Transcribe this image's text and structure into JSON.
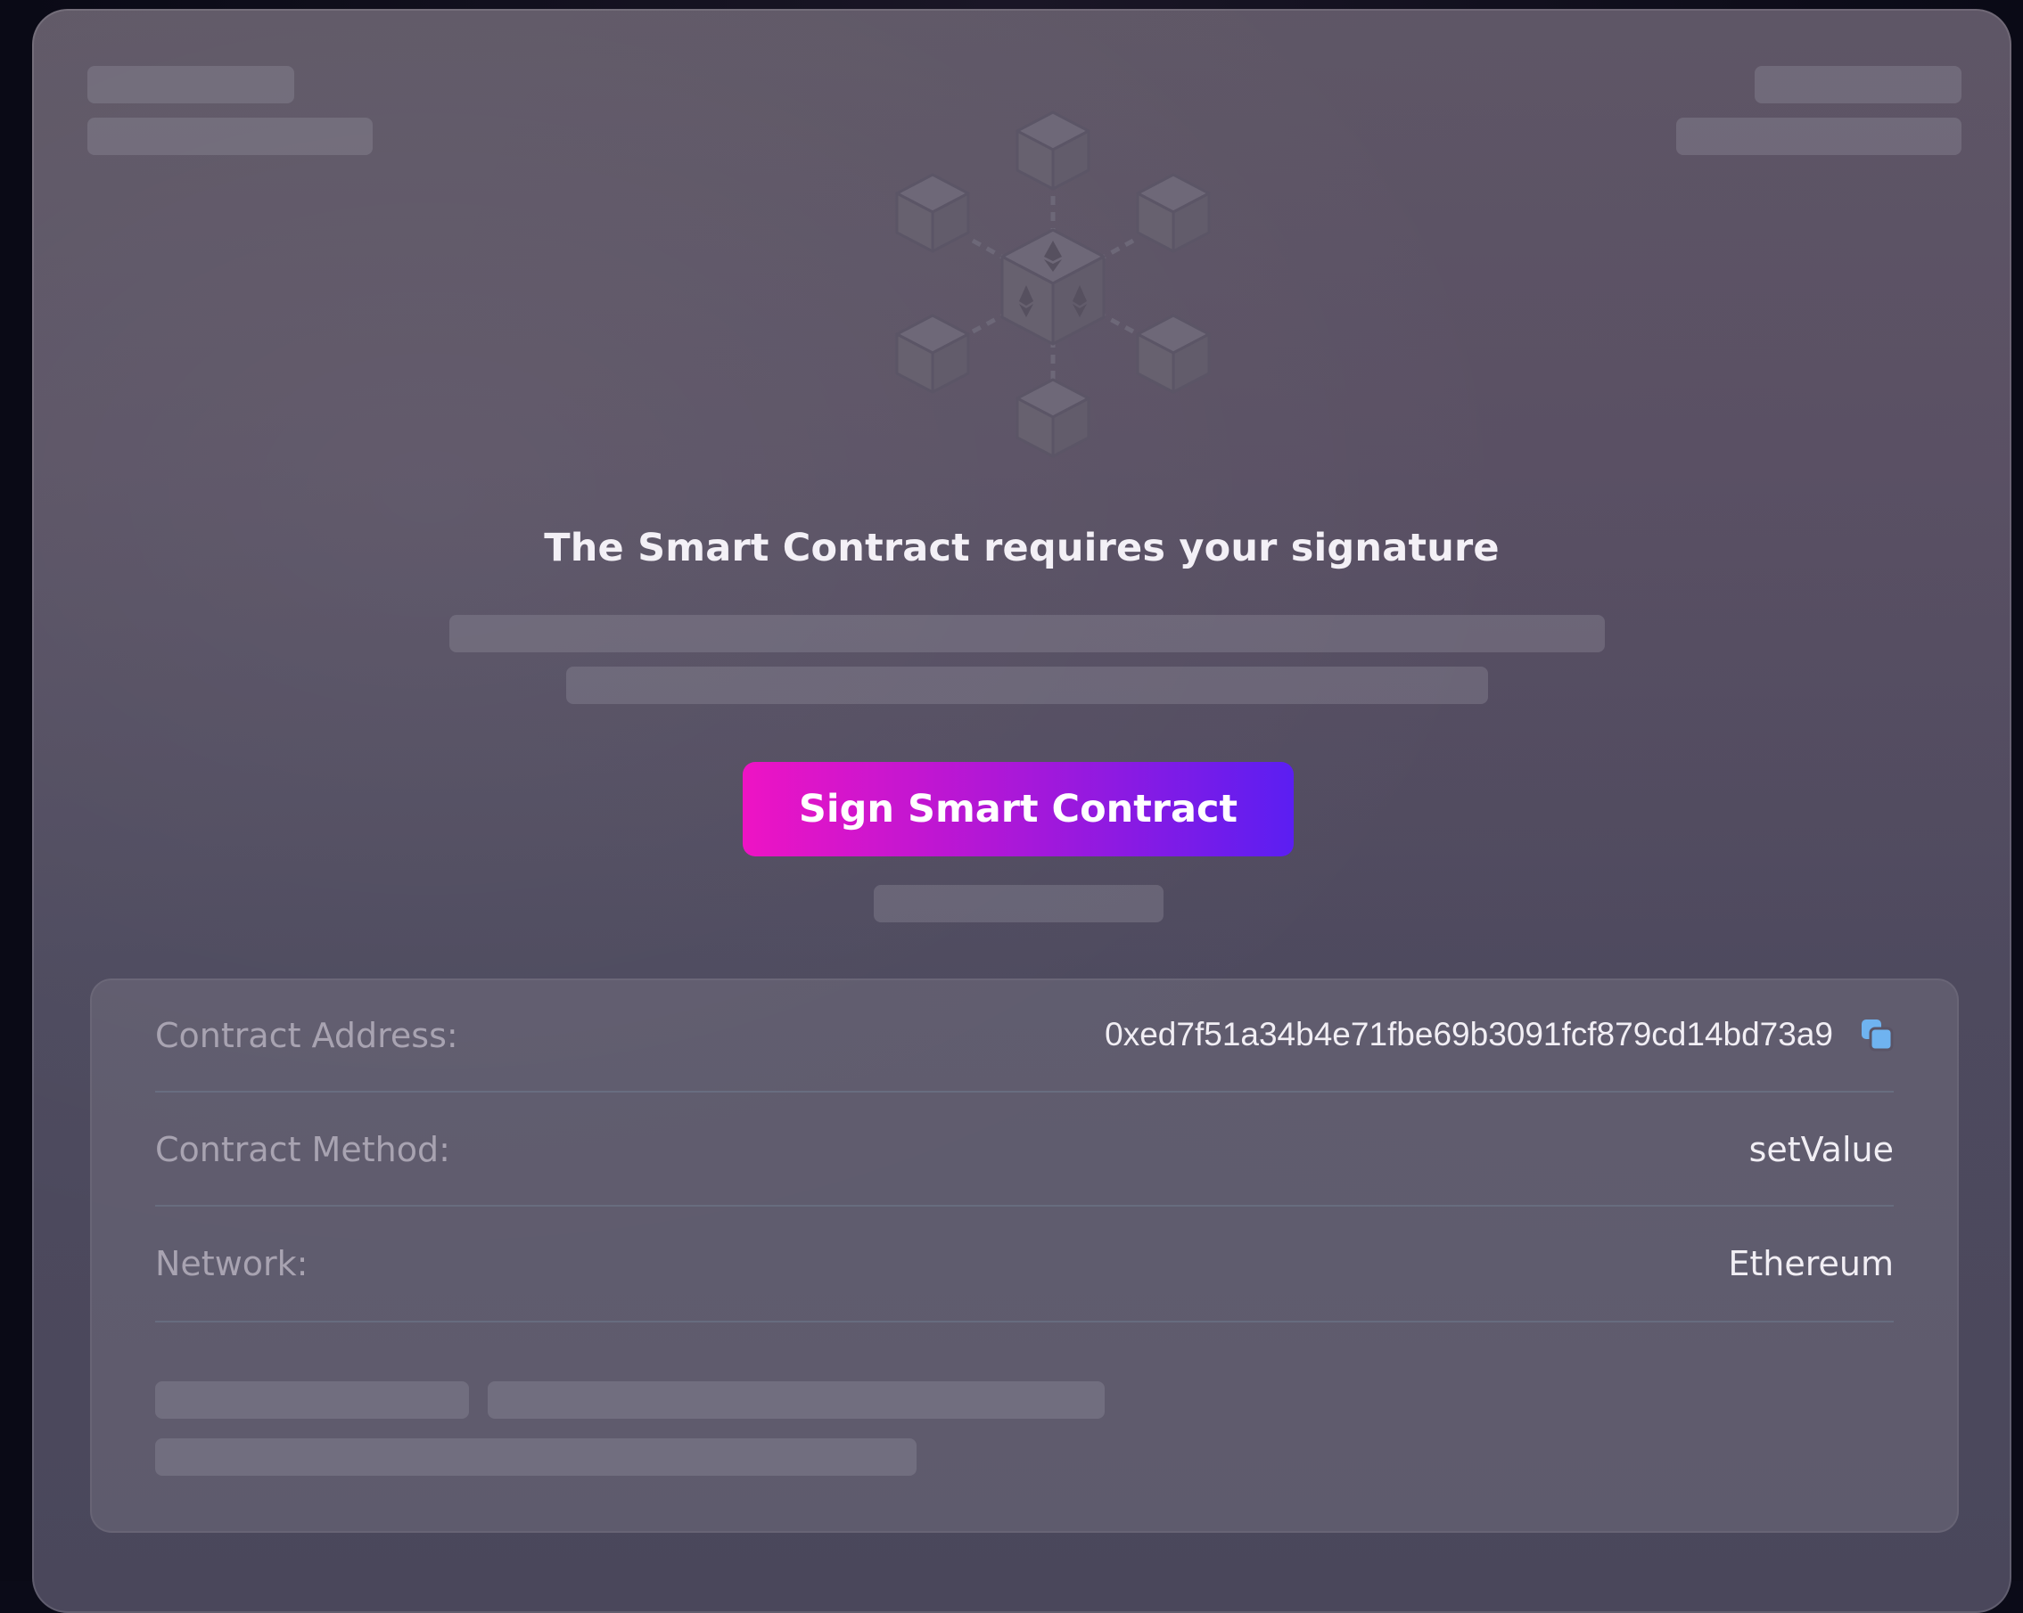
{
  "dialog": {
    "title": "The Smart Contract requires your signature",
    "sign_button_label": "Sign Smart Contract"
  },
  "hero": {
    "icon": "blockchain-network-icon"
  },
  "details": {
    "rows": [
      {
        "label": "Contract Address:",
        "value": "0xed7f51a34b4e71fbe69b3091fcf879cd14bd73a9"
      },
      {
        "label": "Contract Method:",
        "value": "setValue"
      },
      {
        "label": "Network:",
        "value": "Ethereum"
      }
    ],
    "copy_icon": "copy-icon"
  },
  "colors": {
    "button_gradient_start": "#ee14c4",
    "button_gradient_end": "#5b1ef2",
    "copy_icon": "#6fb3f0"
  }
}
